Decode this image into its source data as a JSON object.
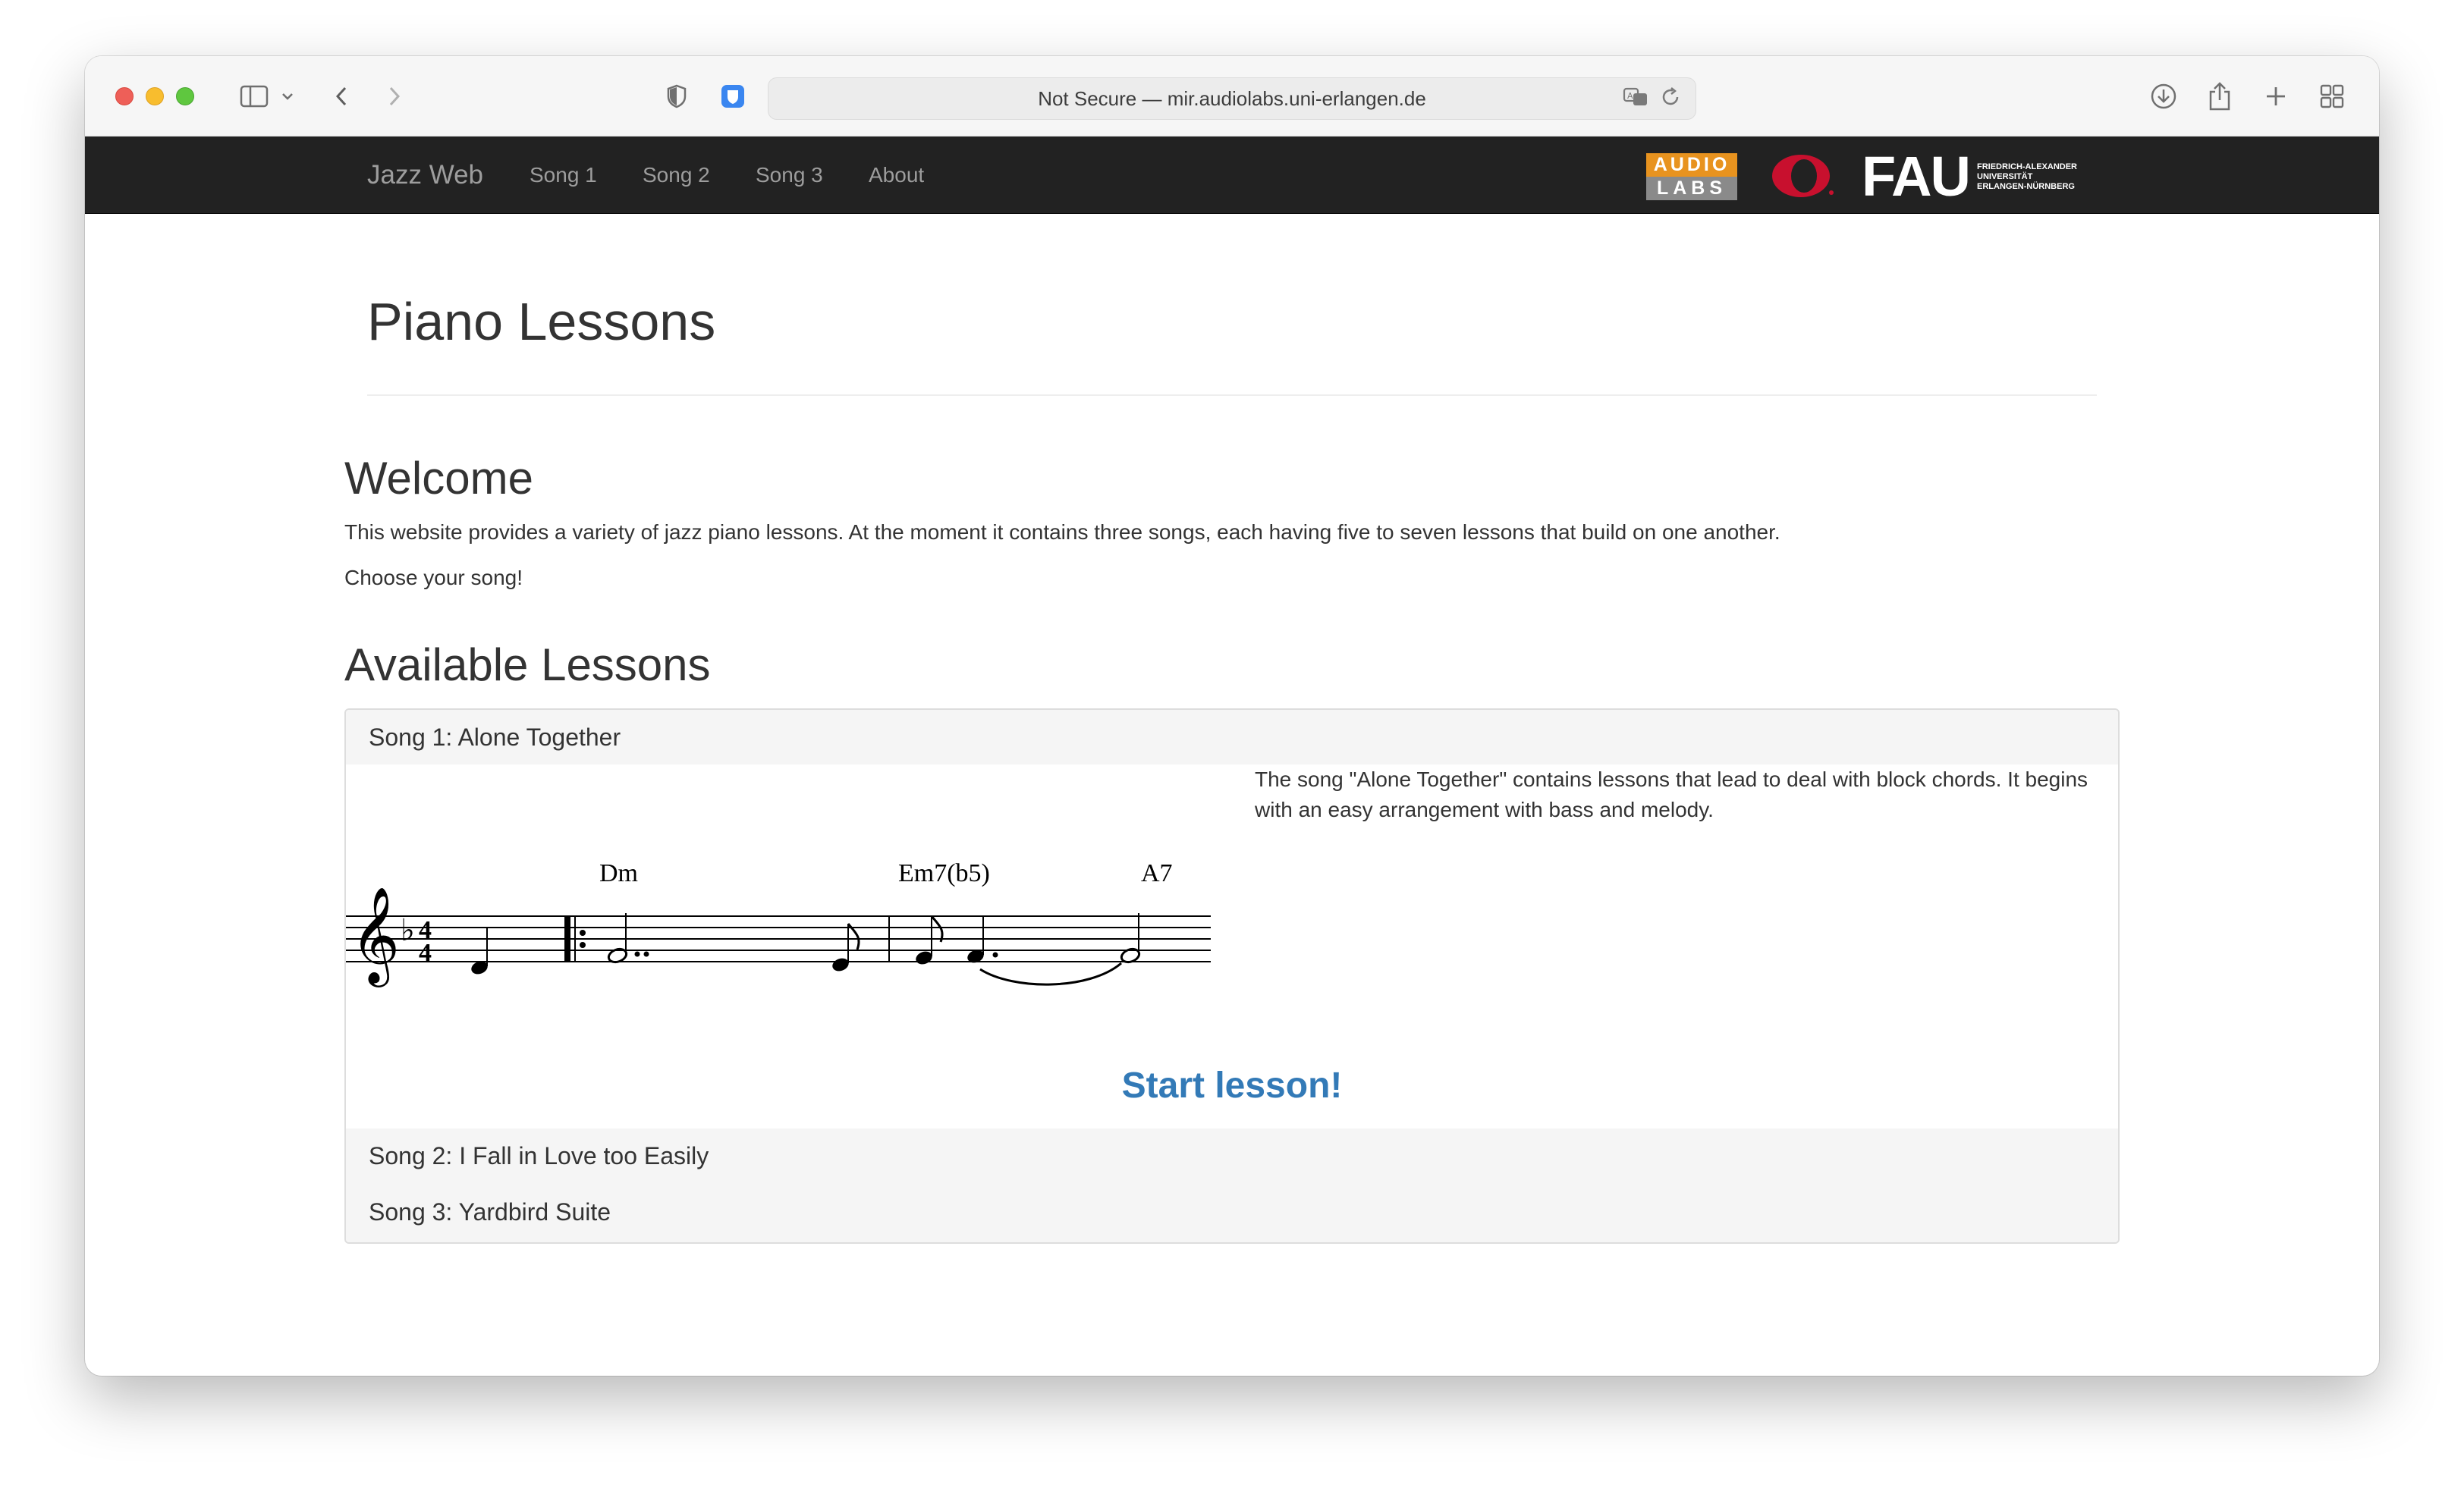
{
  "browser": {
    "address": "Not Secure — mir.audiolabs.uni-erlangen.de"
  },
  "navbar": {
    "brand": "Jazz Web",
    "links": [
      "Song 1",
      "Song 2",
      "Song 3",
      "About"
    ],
    "logos": {
      "audiolabs_top": "AUDIO",
      "audiolabs_bottom": "LABS",
      "fau": "FAU",
      "fau_sub": [
        "FRIEDRICH-ALEXANDER",
        "UNIVERSITÄT",
        "ERLANGEN-NÜRNBERG"
      ]
    }
  },
  "page": {
    "title": "Piano Lessons",
    "welcome_heading": "Welcome",
    "welcome_text": "This website provides a variety of jazz piano lessons. At the moment it contains three songs, each having five to seven lessons that build on one another.",
    "choose_text": "Choose your song!",
    "lessons_heading": "Available Lessons"
  },
  "lessons": {
    "song1": {
      "title": "Song 1: Alone Together",
      "description": "The song \"Alone Together\" contains lessons that lead to deal with block chords. It begins with an easy arrangement with bass and melody.",
      "chords": [
        "Dm",
        "Em7(b5)",
        "A7"
      ],
      "start_label": "Start lesson!"
    },
    "song2": {
      "title": "Song 2: I Fall in Love too Easily"
    },
    "song3": {
      "title": "Song 3: Yardbird Suite"
    }
  },
  "colors": {
    "navbar_bg": "#222222",
    "link_blue": "#337ab7",
    "audiolabs_orange": "#e8931f",
    "fau_red": "#c8102e"
  }
}
